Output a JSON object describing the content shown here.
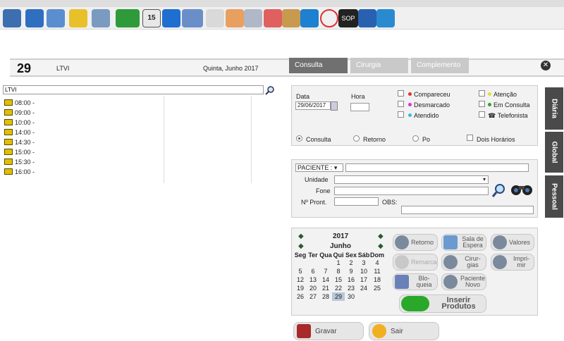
{
  "toolbar": {
    "icons": [
      "people-icon",
      "book-icon",
      "folder-icon",
      "chart-icon",
      "coins-icon",
      "money-icon",
      "calendar-15-icon",
      "phone-icon",
      "calculator-icon",
      "notepad-icon",
      "doctor-icon",
      "printer-icon",
      "gift-icon",
      "package-icon",
      "plane-icon",
      "record-icon",
      "sop-icon",
      "handshake-icon",
      "exit-icon"
    ],
    "sop_label": "SOP",
    "calendar_label": "15"
  },
  "header": {
    "day": "29",
    "agenda": "LTVI",
    "date": "Quinta, Junho 2017"
  },
  "tabs": [
    {
      "label": "Consulta"
    },
    {
      "label": "Cirurgia"
    },
    {
      "label": "Complemento"
    }
  ],
  "close_label": "✕",
  "search": {
    "value": "LTVI"
  },
  "slots": [
    "08:00 -",
    "09:00 -",
    "10:00 -",
    "14:00 -",
    "14:30 -",
    "15:00 -",
    "15:30 -",
    "16:00 -"
  ],
  "form": {
    "data_label": "Data",
    "data_value": "29/06/2017",
    "hora_label": "Hora",
    "status": [
      {
        "label": "Compareceu",
        "color": "#e03030"
      },
      {
        "label": "Desmarcado",
        "color": "#e030e0"
      },
      {
        "label": "Atendido",
        "color": "#30c0e0"
      },
      {
        "label": "Atenção",
        "color": "#e0e030"
      },
      {
        "label": "Em Consulta",
        "color": "#30a030"
      },
      {
        "label": "Telefonista",
        "color": "#333333"
      }
    ],
    "radios": [
      "Consulta",
      "Retorno",
      "Po"
    ],
    "dois_horarios": "Dois Horários"
  },
  "patient": {
    "select_label": "PACIENTE :",
    "unidade": "Unidade",
    "fone": "Fone",
    "pront": "Nº Pront.",
    "obs": "OBS:"
  },
  "side_tabs": [
    "Diária",
    "Global",
    "Pessoal"
  ],
  "calendar": {
    "year": "2017",
    "month": "Junho",
    "weekdays": [
      "Seg",
      "Ter",
      "Qua",
      "Qui",
      "Sex",
      "Sáb",
      "Dom"
    ],
    "weeks": [
      [
        "",
        "",
        "",
        "1",
        "2",
        "3",
        "4"
      ],
      [
        "5",
        "6",
        "7",
        "8",
        "9",
        "10",
        "11"
      ],
      [
        "12",
        "13",
        "14",
        "15",
        "16",
        "17",
        "18"
      ],
      [
        "19",
        "20",
        "21",
        "22",
        "23",
        "24",
        "25"
      ],
      [
        "26",
        "27",
        "28",
        "29",
        "30",
        "",
        ""
      ]
    ],
    "today": "29"
  },
  "cal_buttons": {
    "retorno": "Retorno",
    "sala": "Sala de Espera",
    "valores": "Valores",
    "remarca": "Remarca",
    "cirurgias": "Cirur- gias",
    "imprimir": "Impri- mir",
    "bloqueia": "Blo- queia",
    "paciente_novo": "Paciente Novo",
    "inserir": "Inserir Produtos"
  },
  "actions": {
    "gravar": "Gravar",
    "sair": "Sair"
  }
}
